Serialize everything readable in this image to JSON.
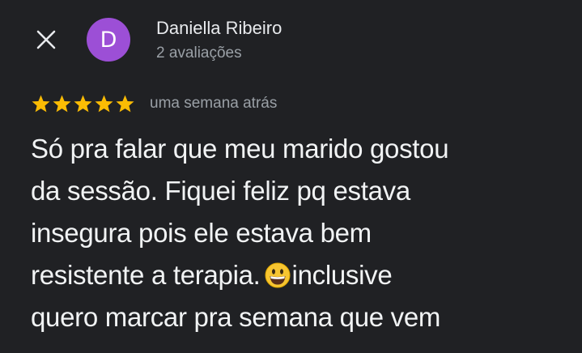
{
  "header": {
    "close_icon": "close-icon",
    "avatar_initial": "D",
    "avatar_color": "#9c4fd6",
    "author_name": "Daniella Ribeiro",
    "author_reviews": "2 avaliações"
  },
  "review": {
    "rating": 5,
    "rating_max": 5,
    "star_color": "#fbbc04",
    "time_ago": "uma semana atrás",
    "lines": {
      "l1": "Só pra falar que meu marido gostou",
      "l2": "da sessão. Fiquei feliz pq estava",
      "l3": "insegura pois ele estava bem",
      "l4a": "resistente a terapia.",
      "l4_emoji": "grinning-face-emoji",
      "l4b": "inclusive",
      "l5": "quero marcar pra semana que vem"
    }
  }
}
